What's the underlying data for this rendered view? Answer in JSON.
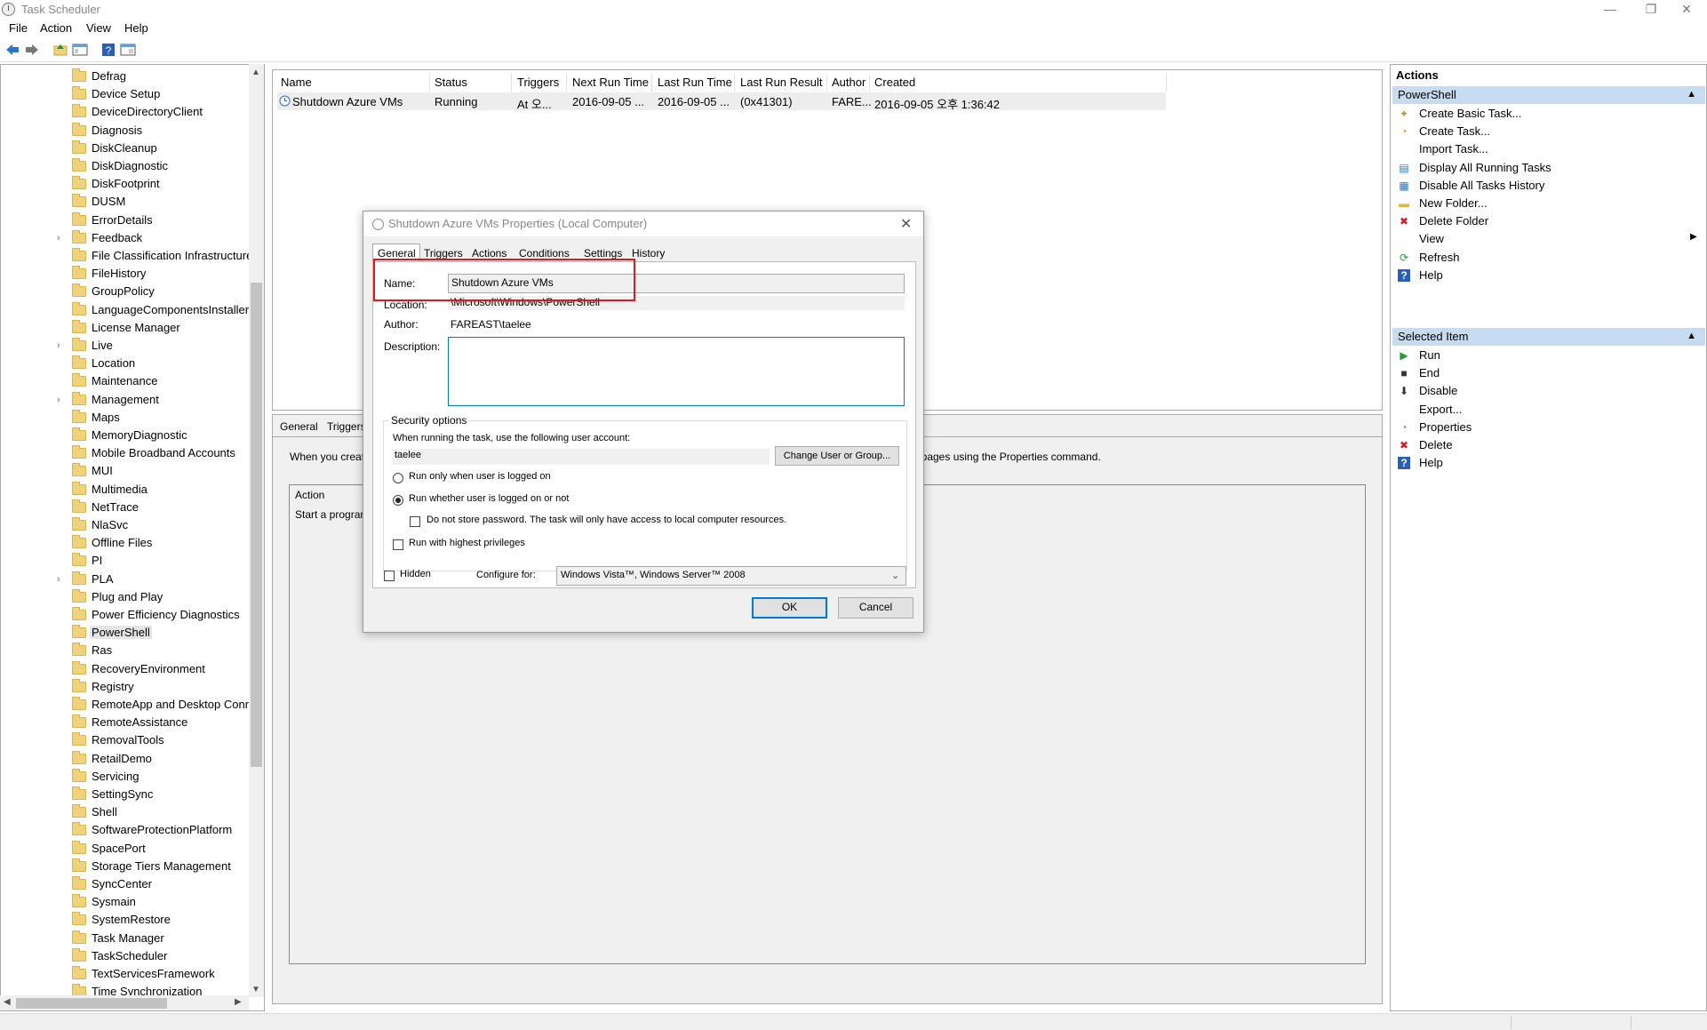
{
  "window": {
    "title": "Task Scheduler",
    "minimize": "—",
    "restore": "❐",
    "close": "✕"
  },
  "menu": [
    "File",
    "Action",
    "View",
    "Help"
  ],
  "tree": {
    "items": [
      {
        "label": "Defrag",
        "expandable": false
      },
      {
        "label": "Device Setup",
        "expandable": false
      },
      {
        "label": "DeviceDirectoryClient",
        "expandable": false
      },
      {
        "label": "Diagnosis",
        "expandable": false
      },
      {
        "label": "DiskCleanup",
        "expandable": false
      },
      {
        "label": "DiskDiagnostic",
        "expandable": false
      },
      {
        "label": "DiskFootprint",
        "expandable": false
      },
      {
        "label": "DUSM",
        "expandable": false
      },
      {
        "label": "ErrorDetails",
        "expandable": false
      },
      {
        "label": "Feedback",
        "expandable": true
      },
      {
        "label": "File Classification Infrastructure",
        "expandable": false
      },
      {
        "label": "FileHistory",
        "expandable": false
      },
      {
        "label": "GroupPolicy",
        "expandable": false
      },
      {
        "label": "LanguageComponentsInstaller",
        "expandable": false
      },
      {
        "label": "License Manager",
        "expandable": false
      },
      {
        "label": "Live",
        "expandable": true
      },
      {
        "label": "Location",
        "expandable": false
      },
      {
        "label": "Maintenance",
        "expandable": false
      },
      {
        "label": "Management",
        "expandable": true
      },
      {
        "label": "Maps",
        "expandable": false
      },
      {
        "label": "MemoryDiagnostic",
        "expandable": false
      },
      {
        "label": "Mobile Broadband Accounts",
        "expandable": false
      },
      {
        "label": "MUI",
        "expandable": false
      },
      {
        "label": "Multimedia",
        "expandable": false
      },
      {
        "label": "NetTrace",
        "expandable": false
      },
      {
        "label": "NlaSvc",
        "expandable": false
      },
      {
        "label": "Offline Files",
        "expandable": false
      },
      {
        "label": "PI",
        "expandable": false
      },
      {
        "label": "PLA",
        "expandable": true
      },
      {
        "label": "Plug and Play",
        "expandable": false
      },
      {
        "label": "Power Efficiency Diagnostics",
        "expandable": false
      },
      {
        "label": "PowerShell",
        "expandable": false,
        "selected": true
      },
      {
        "label": "Ras",
        "expandable": false
      },
      {
        "label": "RecoveryEnvironment",
        "expandable": false
      },
      {
        "label": "Registry",
        "expandable": false
      },
      {
        "label": "RemoteApp and Desktop Conn",
        "expandable": false
      },
      {
        "label": "RemoteAssistance",
        "expandable": false
      },
      {
        "label": "RemovalTools",
        "expandable": false
      },
      {
        "label": "RetailDemo",
        "expandable": false
      },
      {
        "label": "Servicing",
        "expandable": false
      },
      {
        "label": "SettingSync",
        "expandable": false
      },
      {
        "label": "Shell",
        "expandable": false
      },
      {
        "label": "SoftwareProtectionPlatform",
        "expandable": false
      },
      {
        "label": "SpacePort",
        "expandable": false
      },
      {
        "label": "Storage Tiers Management",
        "expandable": false
      },
      {
        "label": "SyncCenter",
        "expandable": false
      },
      {
        "label": "Sysmain",
        "expandable": false
      },
      {
        "label": "SystemRestore",
        "expandable": false
      },
      {
        "label": "Task Manager",
        "expandable": false
      },
      {
        "label": "TaskScheduler",
        "expandable": false
      },
      {
        "label": "TextServicesFramework",
        "expandable": false
      },
      {
        "label": "Time Synchronization",
        "expandable": false
      }
    ]
  },
  "task_list": {
    "columns": [
      "Name",
      "Status",
      "Triggers",
      "Next Run Time",
      "Last Run Time",
      "Last Run Result",
      "Author",
      "Created"
    ],
    "rows": [
      [
        "Shutdown Azure VMs",
        "Running",
        "At 오...",
        "2016-09-05 ...",
        "2016-09-05 ...",
        "(0x41301)",
        "FARE...",
        "2016-09-05 오후 1:36:42"
      ]
    ]
  },
  "bottom": {
    "tabs": [
      "General",
      "Triggers"
    ],
    "info_left": "When you creat",
    "info_right": "rty pages using the Properties command.",
    "grid_header": "Action",
    "grid_row": "Start a program"
  },
  "actions": {
    "header": "Actions",
    "section1": {
      "title": "PowerShell",
      "items": [
        {
          "label": "Create Basic Task...",
          "icon": "wizard-icon"
        },
        {
          "label": "Create Task...",
          "icon": "task-icon"
        },
        {
          "label": "Import Task...",
          "icon": ""
        },
        {
          "label": "Display All Running Tasks",
          "icon": "running-tasks-icon"
        },
        {
          "label": "Disable All Tasks History",
          "icon": "history-icon"
        },
        {
          "label": "New Folder...",
          "icon": "folder-icon"
        },
        {
          "label": "Delete Folder",
          "icon": "delete-icon"
        },
        {
          "label": "View",
          "icon": "",
          "submenu": true
        },
        {
          "label": "Refresh",
          "icon": "refresh-icon"
        },
        {
          "label": "Help",
          "icon": "help-icon"
        }
      ]
    },
    "section2": {
      "title": "Selected Item",
      "items": [
        {
          "label": "Run",
          "icon": "run-icon"
        },
        {
          "label": "End",
          "icon": "end-icon"
        },
        {
          "label": "Disable",
          "icon": "disable-icon"
        },
        {
          "label": "Export...",
          "icon": ""
        },
        {
          "label": "Properties",
          "icon": "properties-icon"
        },
        {
          "label": "Delete",
          "icon": "delete-icon"
        },
        {
          "label": "Help",
          "icon": "help-icon"
        }
      ]
    }
  },
  "dialog": {
    "title": "Shutdown Azure VMs Properties (Local Computer)",
    "close": "✕",
    "tabs": [
      "General",
      "Triggers",
      "Actions",
      "Conditions",
      "Settings",
      "History"
    ],
    "name_label": "Name:",
    "name_value": "Shutdown Azure VMs",
    "location_label": "Location:",
    "location_value": "\\Microsoft\\Windows\\PowerShell",
    "author_label": "Author:",
    "author_value": "FAREAST\\taelee",
    "description_label": "Description:",
    "security_title": "Security options",
    "account_prompt": "When running the task, use the following user account:",
    "account_value": "taelee",
    "change_user_button": "Change User or Group...",
    "radio_logged_on": "Run only when user is logged on",
    "radio_whether": "Run whether user is logged on or not",
    "no_store_password": "Do not store password.  The task will only have access to local computer resources.",
    "highest_privileges": "Run with highest privileges",
    "hidden_label": "Hidden",
    "configure_label": "Configure for:",
    "configure_value": "Windows Vista™, Windows Server™ 2008",
    "ok_button": "OK",
    "cancel_button": "Cancel"
  },
  "colors": {
    "highlight_box": "#e8141b",
    "section_header": "#c7dcf0",
    "default_button_border": "#0078d7"
  }
}
